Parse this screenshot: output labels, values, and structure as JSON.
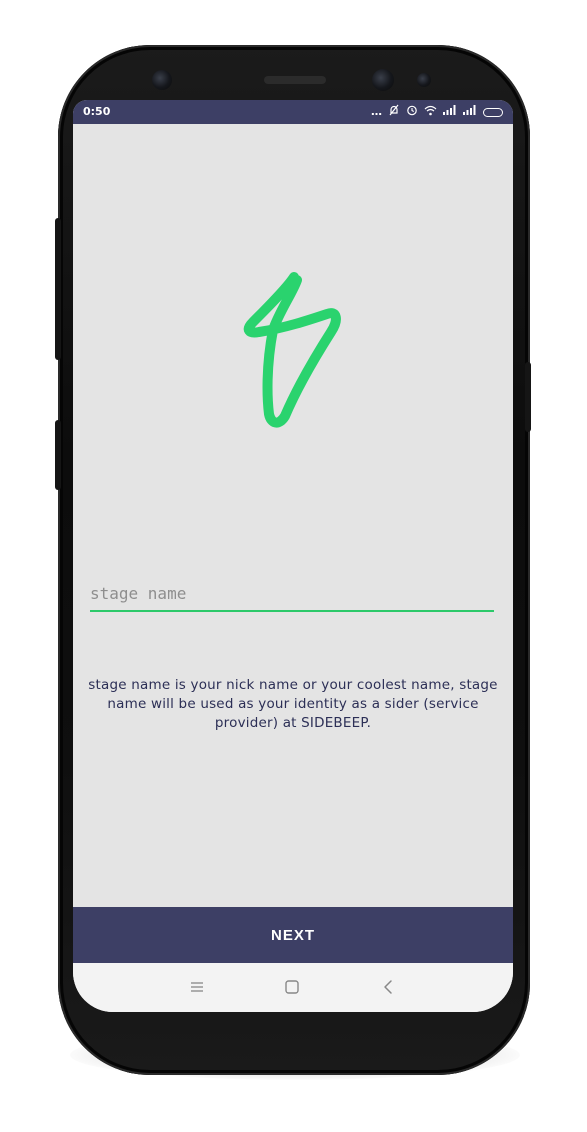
{
  "status_bar": {
    "time": "0:50",
    "icons": [
      "more-dots-icon",
      "notifications-off-icon",
      "alarm-icon",
      "wifi-icon",
      "signal-icon",
      "signal-icon",
      "battery-icon"
    ]
  },
  "logo": {
    "icon": "sidebeep-logo-icon",
    "color": "#2ad36e"
  },
  "form": {
    "stage_name": {
      "value": "",
      "placeholder": "stage name"
    }
  },
  "helper_text": "stage name is your nick name or your coolest name, stage name will be used as your identity as a sider (service provider) at SIDEBEEP.",
  "next_button": {
    "label": "NEXT"
  },
  "nav_bar": {
    "buttons": [
      "recent-apps-icon",
      "home-icon",
      "back-icon"
    ]
  },
  "colors": {
    "primary": "#3d3f65",
    "accent": "#2ad36e",
    "background": "#e4e4e4"
  }
}
